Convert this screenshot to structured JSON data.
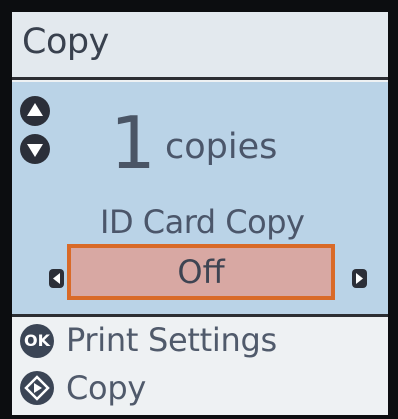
{
  "screen": {
    "title": "Copy"
  },
  "copies": {
    "count": "1",
    "unit": "copies",
    "increase_icon": "arrow-up-icon",
    "decrease_icon": "arrow-down-icon"
  },
  "id_card_copy": {
    "label": "ID Card Copy",
    "value": "Off",
    "prev_icon": "arrow-left-icon",
    "next_icon": "arrow-right-icon"
  },
  "footer": {
    "ok_icon_text": "OK",
    "print_settings_label": "Print Settings",
    "start_label": "Copy"
  },
  "colors": {
    "accent": "#d96a28",
    "panel": "#bad3e7",
    "selected_fill": "#d8a8a3"
  }
}
